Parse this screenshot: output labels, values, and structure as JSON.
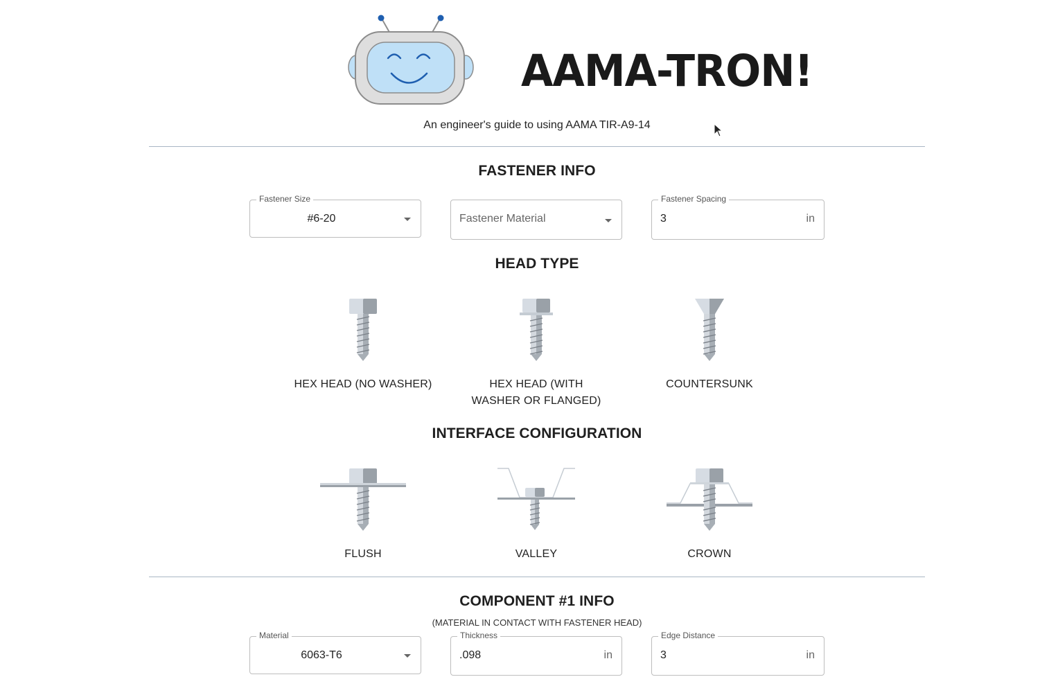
{
  "app": {
    "title": "AAMA-TRON!",
    "subtitle": "An engineer's guide to using AAMA TIR-A9-14",
    "logo_icon": "robot-icon"
  },
  "fastener_info": {
    "heading": "FASTENER INFO",
    "size": {
      "label": "Fastener Size",
      "value": "#6-20"
    },
    "material": {
      "placeholder": "Fastener Material",
      "value": ""
    },
    "spacing": {
      "label": "Fastener Spacing",
      "value": "3",
      "unit": "in"
    }
  },
  "head_type": {
    "heading": "HEAD TYPE",
    "options": [
      {
        "label": "HEX HEAD (NO WASHER)",
        "icon": "hex-head-screw-icon"
      },
      {
        "label": "HEX HEAD (WITH WASHER OR FLANGED)",
        "icon": "hex-washer-screw-icon"
      },
      {
        "label": "COUNTERSUNK",
        "icon": "countersunk-screw-icon"
      }
    ]
  },
  "interface_config": {
    "heading": "INTERFACE CONFIGURATION",
    "options": [
      {
        "label": "FLUSH",
        "icon": "flush-interface-icon"
      },
      {
        "label": "VALLEY",
        "icon": "valley-interface-icon"
      },
      {
        "label": "CROWN",
        "icon": "crown-interface-icon"
      }
    ]
  },
  "component1": {
    "heading": "COMPONENT #1 INFO",
    "note": "(MATERIAL IN CONTACT WITH FASTENER HEAD)",
    "material": {
      "label": "Material",
      "value": "6063-T6"
    },
    "thickness": {
      "label": "Thickness",
      "value": ".098",
      "unit": "in"
    },
    "edge_distance": {
      "label": "Edge Distance",
      "value": "3",
      "unit": "in"
    }
  },
  "colors": {
    "divider": "#a9b6c4",
    "robot_face": "#bfe0f7",
    "robot_accent": "#1f5fb0",
    "screw_light": "#d6dce3",
    "screw_dark": "#9aa1a8"
  }
}
